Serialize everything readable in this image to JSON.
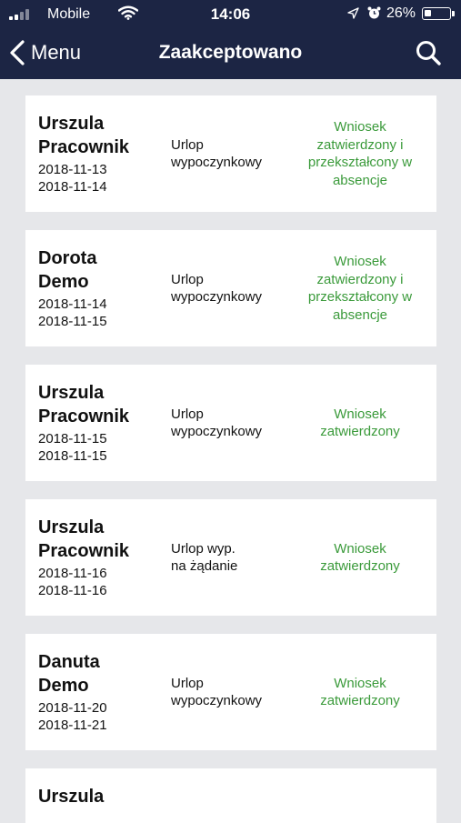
{
  "status_bar": {
    "carrier": "Mobile",
    "time": "14:06",
    "battery_percent": "26%",
    "battery_level": 0.26,
    "icons": [
      "signal-icon",
      "wifi-icon",
      "location-arrow-icon",
      "alarm-icon",
      "battery-icon"
    ]
  },
  "navbar": {
    "back_label": "Menu",
    "title": "Zaakceptowano",
    "icons": [
      "chevron-left-icon",
      "search-icon"
    ]
  },
  "colors": {
    "navbar_bg": "#1c2544",
    "page_bg": "#e6e7ea",
    "status_green": "#3a9a3a"
  },
  "requests": [
    {
      "name_first": "Urszula",
      "name_last": "Pracownik",
      "date_from": "2018-11-13",
      "date_to": "2018-11-14",
      "type_line1": "Urlop",
      "type_line2": "wypoczynkowy",
      "status_line1": "Wniosek",
      "status_line2": "zatwierdzony i",
      "status_line3": "przekształcony w",
      "status_line4": "absencje"
    },
    {
      "name_first": "Dorota",
      "name_last": "Demo",
      "date_from": "2018-11-14",
      "date_to": "2018-11-15",
      "type_line1": "Urlop",
      "type_line2": "wypoczynkowy",
      "status_line1": "Wniosek",
      "status_line2": "zatwierdzony i",
      "status_line3": "przekształcony w",
      "status_line4": "absencje"
    },
    {
      "name_first": "Urszula",
      "name_last": "Pracownik",
      "date_from": "2018-11-15",
      "date_to": "2018-11-15",
      "type_line1": "Urlop",
      "type_line2": "wypoczynkowy",
      "status_line1": "Wniosek",
      "status_line2": "zatwierdzony"
    },
    {
      "name_first": "Urszula",
      "name_last": "Pracownik",
      "date_from": "2018-11-16",
      "date_to": "2018-11-16",
      "type_line1": "Urlop wyp.",
      "type_line2": "na żądanie",
      "status_line1": "Wniosek",
      "status_line2": "zatwierdzony"
    },
    {
      "name_first": "Danuta",
      "name_last": "Demo",
      "date_from": "2018-11-20",
      "date_to": "2018-11-21",
      "type_line1": "Urlop",
      "type_line2": "wypoczynkowy",
      "status_line1": "Wniosek",
      "status_line2": "zatwierdzony"
    },
    {
      "name_first": "Urszula"
    }
  ]
}
